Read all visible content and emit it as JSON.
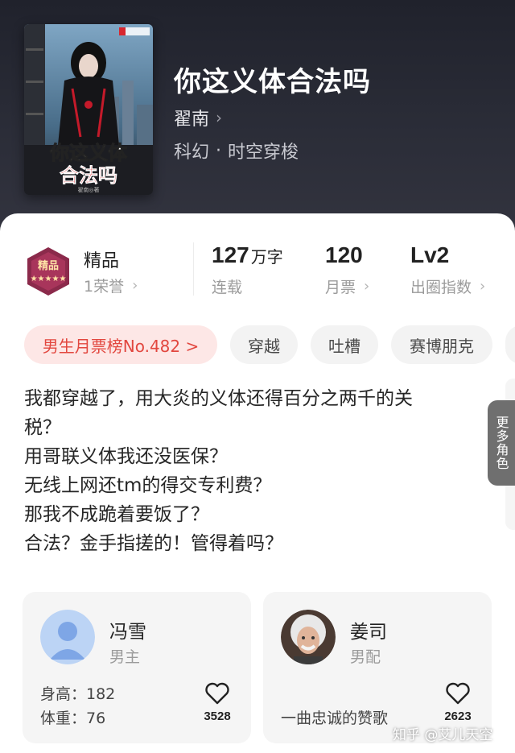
{
  "book": {
    "title": "你这义体合法吗",
    "author": "翟南",
    "genre_primary": "科幻",
    "genre_dot": "·",
    "genre_secondary": "时空穿梭",
    "cover": {
      "title_art": "你这义体合法吗",
      "publisher_mark": "起点读书",
      "author_mark": "翟南◎著"
    }
  },
  "stats": {
    "quality_badge_text": "精品",
    "quality_label": "精品",
    "honor": "1荣誉",
    "word_count": "127",
    "word_unit": "万字",
    "serial_status": "连载",
    "monthly_tickets": "120",
    "monthly_tickets_label": "月票",
    "level": "Lv2",
    "level_label": "出圈指数"
  },
  "tags": [
    {
      "label": "男生月票榜No.482 >"
    },
    {
      "label": "穿越"
    },
    {
      "label": "吐槽"
    },
    {
      "label": "赛博朋克"
    }
  ],
  "synopsis": [
    "我都穿越了，用大炎的义体还得百分之两千的关",
    "税？",
    "用哥联义体我还没医保？",
    "无线上网还tm的得交专利费？",
    "那我不成跪着要饭了？",
    "合法？金手指搓的！管得着吗？"
  ],
  "characters": [
    {
      "name": "冯雪",
      "role": "男主",
      "line1": "身高：182",
      "line2": "体重：76",
      "likes": "3528",
      "avatar": "default-male-avatar"
    },
    {
      "name": "姜司",
      "role": "男配",
      "line1": "",
      "line2": "一曲忠诚的赞歌",
      "likes": "2623",
      "avatar": "elderly-man-avatar"
    }
  ],
  "more_roles_label": "更多角色",
  "watermark": "知乎 @艾儿天空",
  "colors": {
    "header_bg": "#2b2d38",
    "rank_tag_bg": "#fde7e6",
    "rank_tag_text": "#e2473f",
    "badge": "#8b2a4b"
  }
}
